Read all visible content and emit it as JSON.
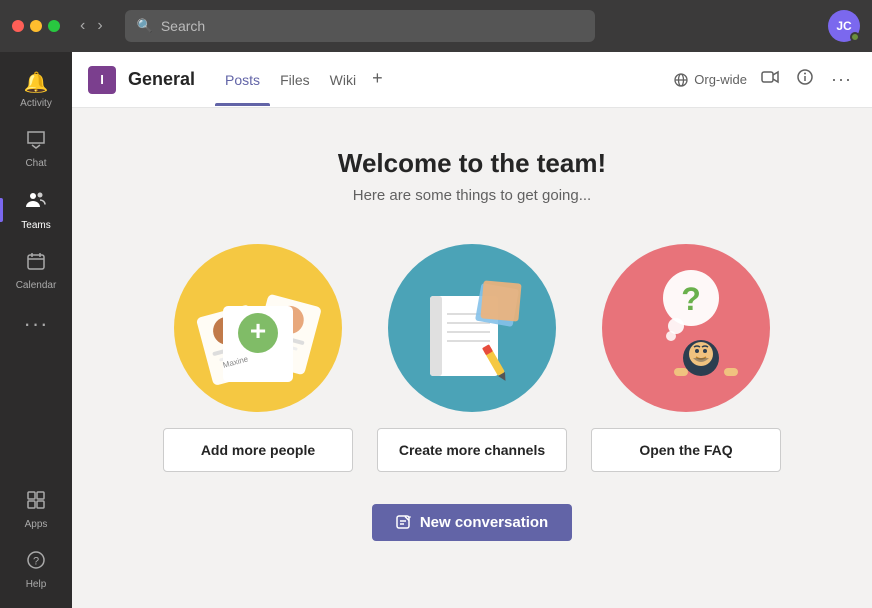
{
  "titlebar": {
    "search_placeholder": "Search",
    "avatar_initials": "JC",
    "back_label": "‹",
    "forward_label": "›"
  },
  "sidebar": {
    "items": [
      {
        "id": "activity",
        "label": "Activity",
        "icon": "🔔",
        "active": false
      },
      {
        "id": "chat",
        "label": "Chat",
        "icon": "💬",
        "active": false
      },
      {
        "id": "teams",
        "label": "Teams",
        "icon": "👥",
        "active": true
      },
      {
        "id": "calendar",
        "label": "Calendar",
        "icon": "📅",
        "active": false
      }
    ],
    "more_label": "···",
    "bottom_items": [
      {
        "id": "apps",
        "label": "Apps",
        "icon": "⊞"
      },
      {
        "id": "help",
        "label": "Help",
        "icon": "?"
      }
    ]
  },
  "channel_header": {
    "team_icon_letter": "I",
    "channel_name": "General",
    "tabs": [
      {
        "id": "posts",
        "label": "Posts",
        "active": true
      },
      {
        "id": "files",
        "label": "Files",
        "active": false
      },
      {
        "id": "wiki",
        "label": "Wiki",
        "active": false
      }
    ],
    "tab_add_label": "+",
    "org_wide_label": "Org-wide",
    "video_icon": "📹",
    "info_icon": "ℹ",
    "more_icon": "···"
  },
  "main": {
    "welcome_title": "Welcome to the team!",
    "welcome_subtitle": "Here are some things to get going...",
    "cards": [
      {
        "id": "add-people",
        "button_label": "Add more people",
        "circle_color": "yellow"
      },
      {
        "id": "create-channels",
        "button_label": "Create more channels",
        "circle_color": "teal"
      },
      {
        "id": "open-faq",
        "button_label": "Open the FAQ",
        "circle_color": "pink"
      }
    ],
    "new_conversation_label": "New conversation",
    "new_convo_icon": "✏"
  }
}
